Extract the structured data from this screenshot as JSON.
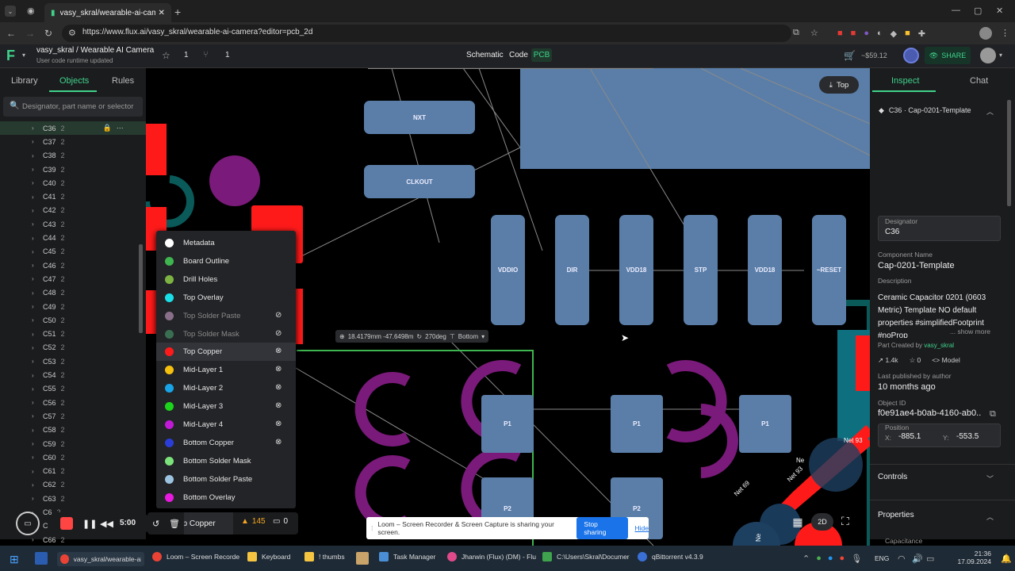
{
  "browser": {
    "tab_title": "vasy_skral/wearable-ai-camera",
    "url": "https://www.flux.ai/vasy_skral/wearable-ai-camera?editor=pcb_2d"
  },
  "header": {
    "project": "vasy_skral / Wearable AI Camera",
    "status": "User code runtime updated",
    "stars": "1",
    "forks": "1",
    "views": [
      "Schematic",
      "Code",
      "PCB"
    ],
    "price": "~$59.12",
    "share": "SHARE"
  },
  "left": {
    "tabs": [
      "Library",
      "Objects",
      "Rules"
    ],
    "search_placeholder": "Designator, part name or selector",
    "rows": [
      {
        "name": "C36",
        "count": "2"
      },
      {
        "name": "C37",
        "count": "2"
      },
      {
        "name": "C38",
        "count": "2"
      },
      {
        "name": "C39",
        "count": "2"
      },
      {
        "name": "C40",
        "count": "2"
      },
      {
        "name": "C41",
        "count": "2"
      },
      {
        "name": "C42",
        "count": "2"
      },
      {
        "name": "C43",
        "count": "2"
      },
      {
        "name": "C44",
        "count": "2"
      },
      {
        "name": "C45",
        "count": "2"
      },
      {
        "name": "C46",
        "count": "2"
      },
      {
        "name": "C47",
        "count": "2"
      },
      {
        "name": "C48",
        "count": "2"
      },
      {
        "name": "C49",
        "count": "2"
      },
      {
        "name": "C50",
        "count": "2"
      },
      {
        "name": "C51",
        "count": "2"
      },
      {
        "name": "C52",
        "count": "2"
      },
      {
        "name": "C53",
        "count": "2"
      },
      {
        "name": "C54",
        "count": "2"
      },
      {
        "name": "C55",
        "count": "2"
      },
      {
        "name": "C56",
        "count": "2"
      },
      {
        "name": "C57",
        "count": "2"
      },
      {
        "name": "C58",
        "count": "2"
      },
      {
        "name": "C59",
        "count": "2"
      },
      {
        "name": "C60",
        "count": "2"
      },
      {
        "name": "C61",
        "count": "2"
      },
      {
        "name": "C62",
        "count": "2"
      },
      {
        "name": "C63",
        "count": "2"
      },
      {
        "name": "C6",
        "count": "2"
      },
      {
        "name": "C6",
        "count": "2"
      },
      {
        "name": "C66",
        "count": "2"
      }
    ]
  },
  "layers": [
    {
      "name": "Metadata",
      "color": "#ffffff",
      "hidden": false
    },
    {
      "name": "Board Outline",
      "color": "#3fb550",
      "hidden": false
    },
    {
      "name": "Drill Holes",
      "color": "#7cb342",
      "hidden": false
    },
    {
      "name": "Top Overlay",
      "color": "#19e0e8",
      "hidden": false
    },
    {
      "name": "Top Solder Paste",
      "color": "#8a6f8a",
      "hidden": true
    },
    {
      "name": "Top Solder Mask",
      "color": "#3a6e52",
      "hidden": true
    },
    {
      "name": "Top Copper",
      "color": "#ff1a1a",
      "hidden": false
    },
    {
      "name": "Mid-Layer 1",
      "color": "#f5c10e",
      "hidden": false
    },
    {
      "name": "Mid-Layer 2",
      "color": "#19a3e8",
      "hidden": false
    },
    {
      "name": "Mid-Layer 3",
      "color": "#1bd41b",
      "hidden": false
    },
    {
      "name": "Mid-Layer 4",
      "color": "#c01ad6",
      "hidden": false
    },
    {
      "name": "Bottom Copper",
      "color": "#2a3dd6",
      "hidden": false
    },
    {
      "name": "Bottom Solder Mask",
      "color": "#7ce37c",
      "hidden": false
    },
    {
      "name": "Bottom Solder Paste",
      "color": "#9cc3e0",
      "hidden": false
    },
    {
      "name": "Bottom Overlay",
      "color": "#e81ae0",
      "hidden": false
    }
  ],
  "canvas": {
    "top_button": "Top",
    "coords": "18.4179mm -47.6498m",
    "angle": "270deg",
    "side": "Bottom",
    "pads": [
      "NXT",
      "CLKOUT",
      "VDDIO",
      "DIR",
      "VDD18",
      "STP",
      "VDD18",
      "~RESET",
      "P1",
      "P1",
      "P1",
      "P2",
      "P2"
    ],
    "nets": [
      "Net 93",
      "Net 93",
      "Net 69",
      "Ne",
      "Ne"
    ],
    "mode_2d": "2D"
  },
  "toolbar": {
    "layer": "Top Copper",
    "warnings": "145",
    "comments": "0"
  },
  "recorder": {
    "time": "5:00",
    "sharing_text": "Loom – Screen Recorder & Screen Capture is sharing your screen.",
    "stop": "Stop sharing",
    "hide": "Hide"
  },
  "right": {
    "tabs": [
      "Inspect",
      "Chat"
    ],
    "part_title": "C36 · Cap-0201-Template",
    "designator_label": "Designator",
    "designator": "C36",
    "component_name_label": "Component Name",
    "component_name": "Cap-0201-Template",
    "description_label": "Description",
    "description": "Ceramic Capacitor 0201 (0603 Metric) Template NO default properties #simplifiedFootprint #noProp",
    "show_more": "... show more",
    "created_by_label": "Part Created by",
    "created_by": "vasy_skral",
    "views": "1.4k",
    "stars": "0",
    "model": "Model",
    "published_label": "Last published by author",
    "published": "10 months ago",
    "object_id_label": "Object ID",
    "object_id": "f0e91ae4-b0ab-4160-ab0...",
    "position_label": "Position",
    "x_label": "X:",
    "x": "-885.1",
    "y_label": "Y:",
    "y": "-553.5",
    "controls": "Controls",
    "properties": "Properties",
    "capacitance": "Capacitance"
  },
  "taskbar": {
    "items": [
      "vasy_skral/wearable-ai-...",
      "Loom – Screen Recorde",
      "Keyboard",
      "! thumbs",
      "Task Manager",
      "Jharwin (Flux) (DM) - Flu",
      "C:\\Users\\Skral\\Documer",
      "qBittorrent v4.3.9"
    ],
    "lang": "ENG",
    "time": "21:36",
    "date": "17.09.2024"
  }
}
